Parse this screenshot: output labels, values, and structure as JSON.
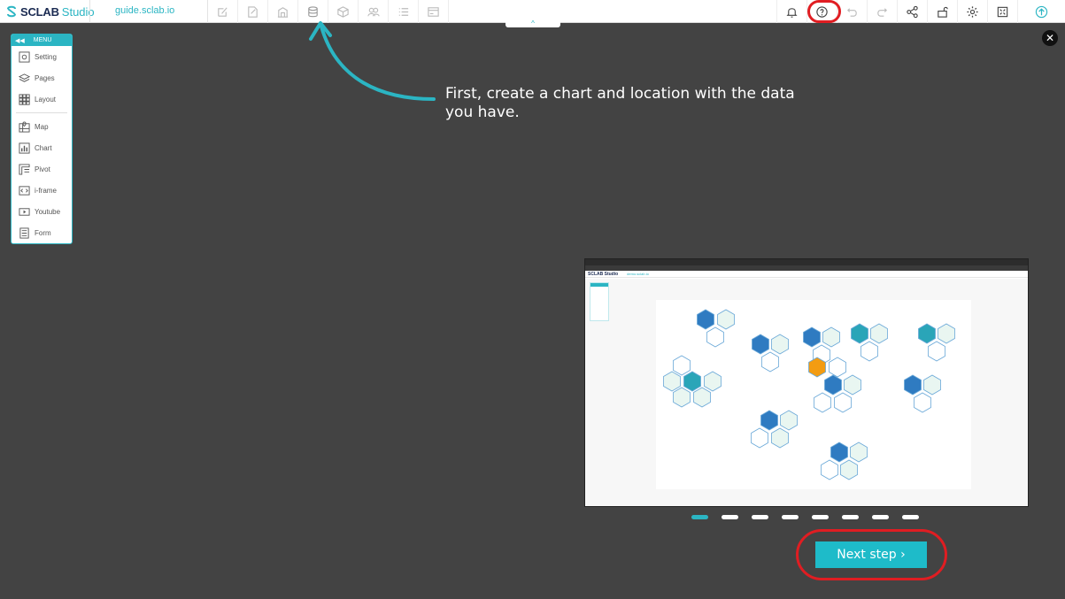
{
  "brand": {
    "name": "SCLAB",
    "sub": "Studio"
  },
  "project": {
    "url": "guide.sclab.io"
  },
  "menu": {
    "title": "MENU",
    "items": [
      {
        "label": "Setting",
        "icon": "gear-square-icon"
      },
      {
        "label": "Pages",
        "icon": "layers-icon"
      },
      {
        "label": "Layout",
        "icon": "grid-icon"
      },
      {
        "label": "Map",
        "icon": "map-icon"
      },
      {
        "label": "Chart",
        "icon": "bar-chart-icon"
      },
      {
        "label": "Pivot",
        "icon": "pivot-table-icon"
      },
      {
        "label": "i-frame",
        "icon": "code-icon"
      },
      {
        "label": "Youtube",
        "icon": "video-icon"
      },
      {
        "label": "Form",
        "icon": "form-icon"
      }
    ]
  },
  "guide": {
    "text": "First, create a chart and location with the data you have.",
    "next_label": "Next step ›",
    "steps_total": 8,
    "current_step": 1
  },
  "preview": {
    "brand": "SCLAB Studio",
    "url": "demo.sclab.io"
  },
  "colors": {
    "accent": "#2bb5c3",
    "highlight": "#e01d22",
    "overlay": "#434343"
  }
}
